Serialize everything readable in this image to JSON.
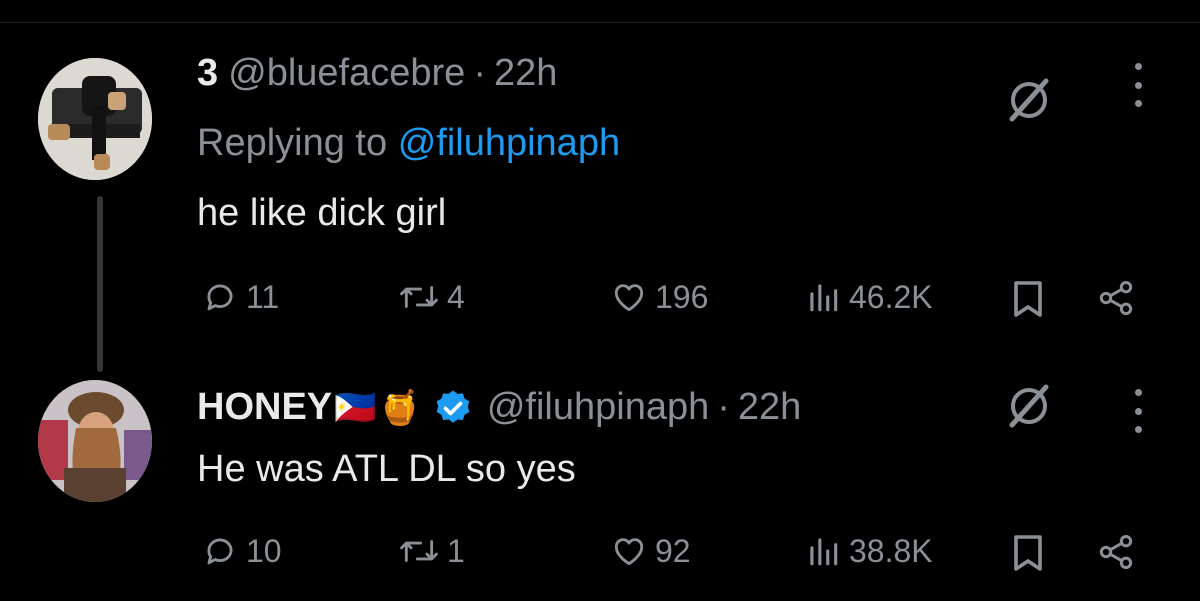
{
  "colors": {
    "background": "#000000",
    "text": "#e7e9ea",
    "muted": "#8b9096",
    "accent": "#1d9bf0",
    "verified": "#1d9bf0"
  },
  "post1": {
    "display_name": "3",
    "handle": "@bluefacebre",
    "separator": "·",
    "time": "22h",
    "replying_prefix": "Replying to",
    "replying_handle": "@filuhpinaph",
    "text": "he like dick girl",
    "replies": "11",
    "reposts": "4",
    "likes": "196",
    "views": "46.2K",
    "icons": [
      "grok-icon",
      "more-icon",
      "reply-icon",
      "repost-icon",
      "like-icon",
      "views-icon",
      "bookmark-icon",
      "share-icon"
    ]
  },
  "post2": {
    "display_name": "HONEY",
    "name_emojis": [
      "🇵🇭",
      "🍯"
    ],
    "handle": "@filuhpinaph",
    "separator": "·",
    "time": "22h",
    "text": "He was ATL DL so yes",
    "replies": "10",
    "reposts": "1",
    "likes": "92",
    "views": "38.8K",
    "icons": [
      "verified-badge-icon",
      "grok-icon",
      "more-icon",
      "reply-icon",
      "repost-icon",
      "like-icon",
      "views-icon",
      "bookmark-icon",
      "share-icon"
    ]
  }
}
